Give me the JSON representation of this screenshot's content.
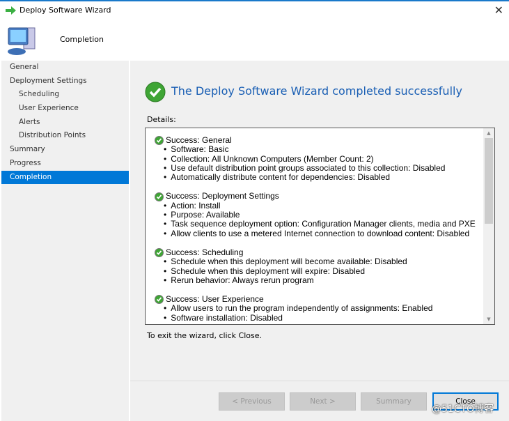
{
  "window": {
    "title": "Deploy Software Wizard",
    "close_icon": "✕"
  },
  "header": {
    "title": "Completion"
  },
  "sidebar": {
    "items": [
      {
        "label": "General",
        "sub": false,
        "active": false
      },
      {
        "label": "Deployment Settings",
        "sub": false,
        "active": false
      },
      {
        "label": "Scheduling",
        "sub": true,
        "active": false
      },
      {
        "label": "User Experience",
        "sub": true,
        "active": false
      },
      {
        "label": "Alerts",
        "sub": true,
        "active": false
      },
      {
        "label": "Distribution Points",
        "sub": true,
        "active": false
      },
      {
        "label": "Summary",
        "sub": false,
        "active": false
      },
      {
        "label": "Progress",
        "sub": false,
        "active": false
      },
      {
        "label": "Completion",
        "sub": false,
        "active": true
      }
    ]
  },
  "main": {
    "headline": "The Deploy Software Wizard completed successfully",
    "details_label": "Details:",
    "sections": [
      {
        "title": "Success: General",
        "items": [
          "Software: Basic",
          "Collection: All Unknown Computers (Member Count: 2)",
          "Use default distribution point groups associated to this collection: Disabled",
          "Automatically distribute content for dependencies: Disabled"
        ]
      },
      {
        "title": "Success: Deployment Settings",
        "items": [
          "Action: Install",
          "Purpose: Available",
          "Task sequence deployment option: Configuration Manager clients, media and PXE",
          "Allow clients to use a metered Internet connection to download content: Disabled"
        ]
      },
      {
        "title": "Success: Scheduling",
        "items": [
          "Schedule when this deployment will become available: Disabled",
          "Schedule when this deployment will expire: Disabled",
          "Rerun behavior: Always rerun program"
        ]
      },
      {
        "title": "Success: User Experience",
        "items": [
          "Allow users to run the program independently of assignments: Enabled",
          "Software installation: Disabled"
        ]
      }
    ],
    "exit_text": "To exit the wizard, click Close."
  },
  "footer": {
    "previous": "< Previous",
    "next": "Next >",
    "summary": "Summary",
    "close": "Close"
  },
  "watermark": "@51CTO博客",
  "colors": {
    "accent": "#0078d7",
    "headline": "#1a5fb4",
    "success": "#3fa535"
  }
}
